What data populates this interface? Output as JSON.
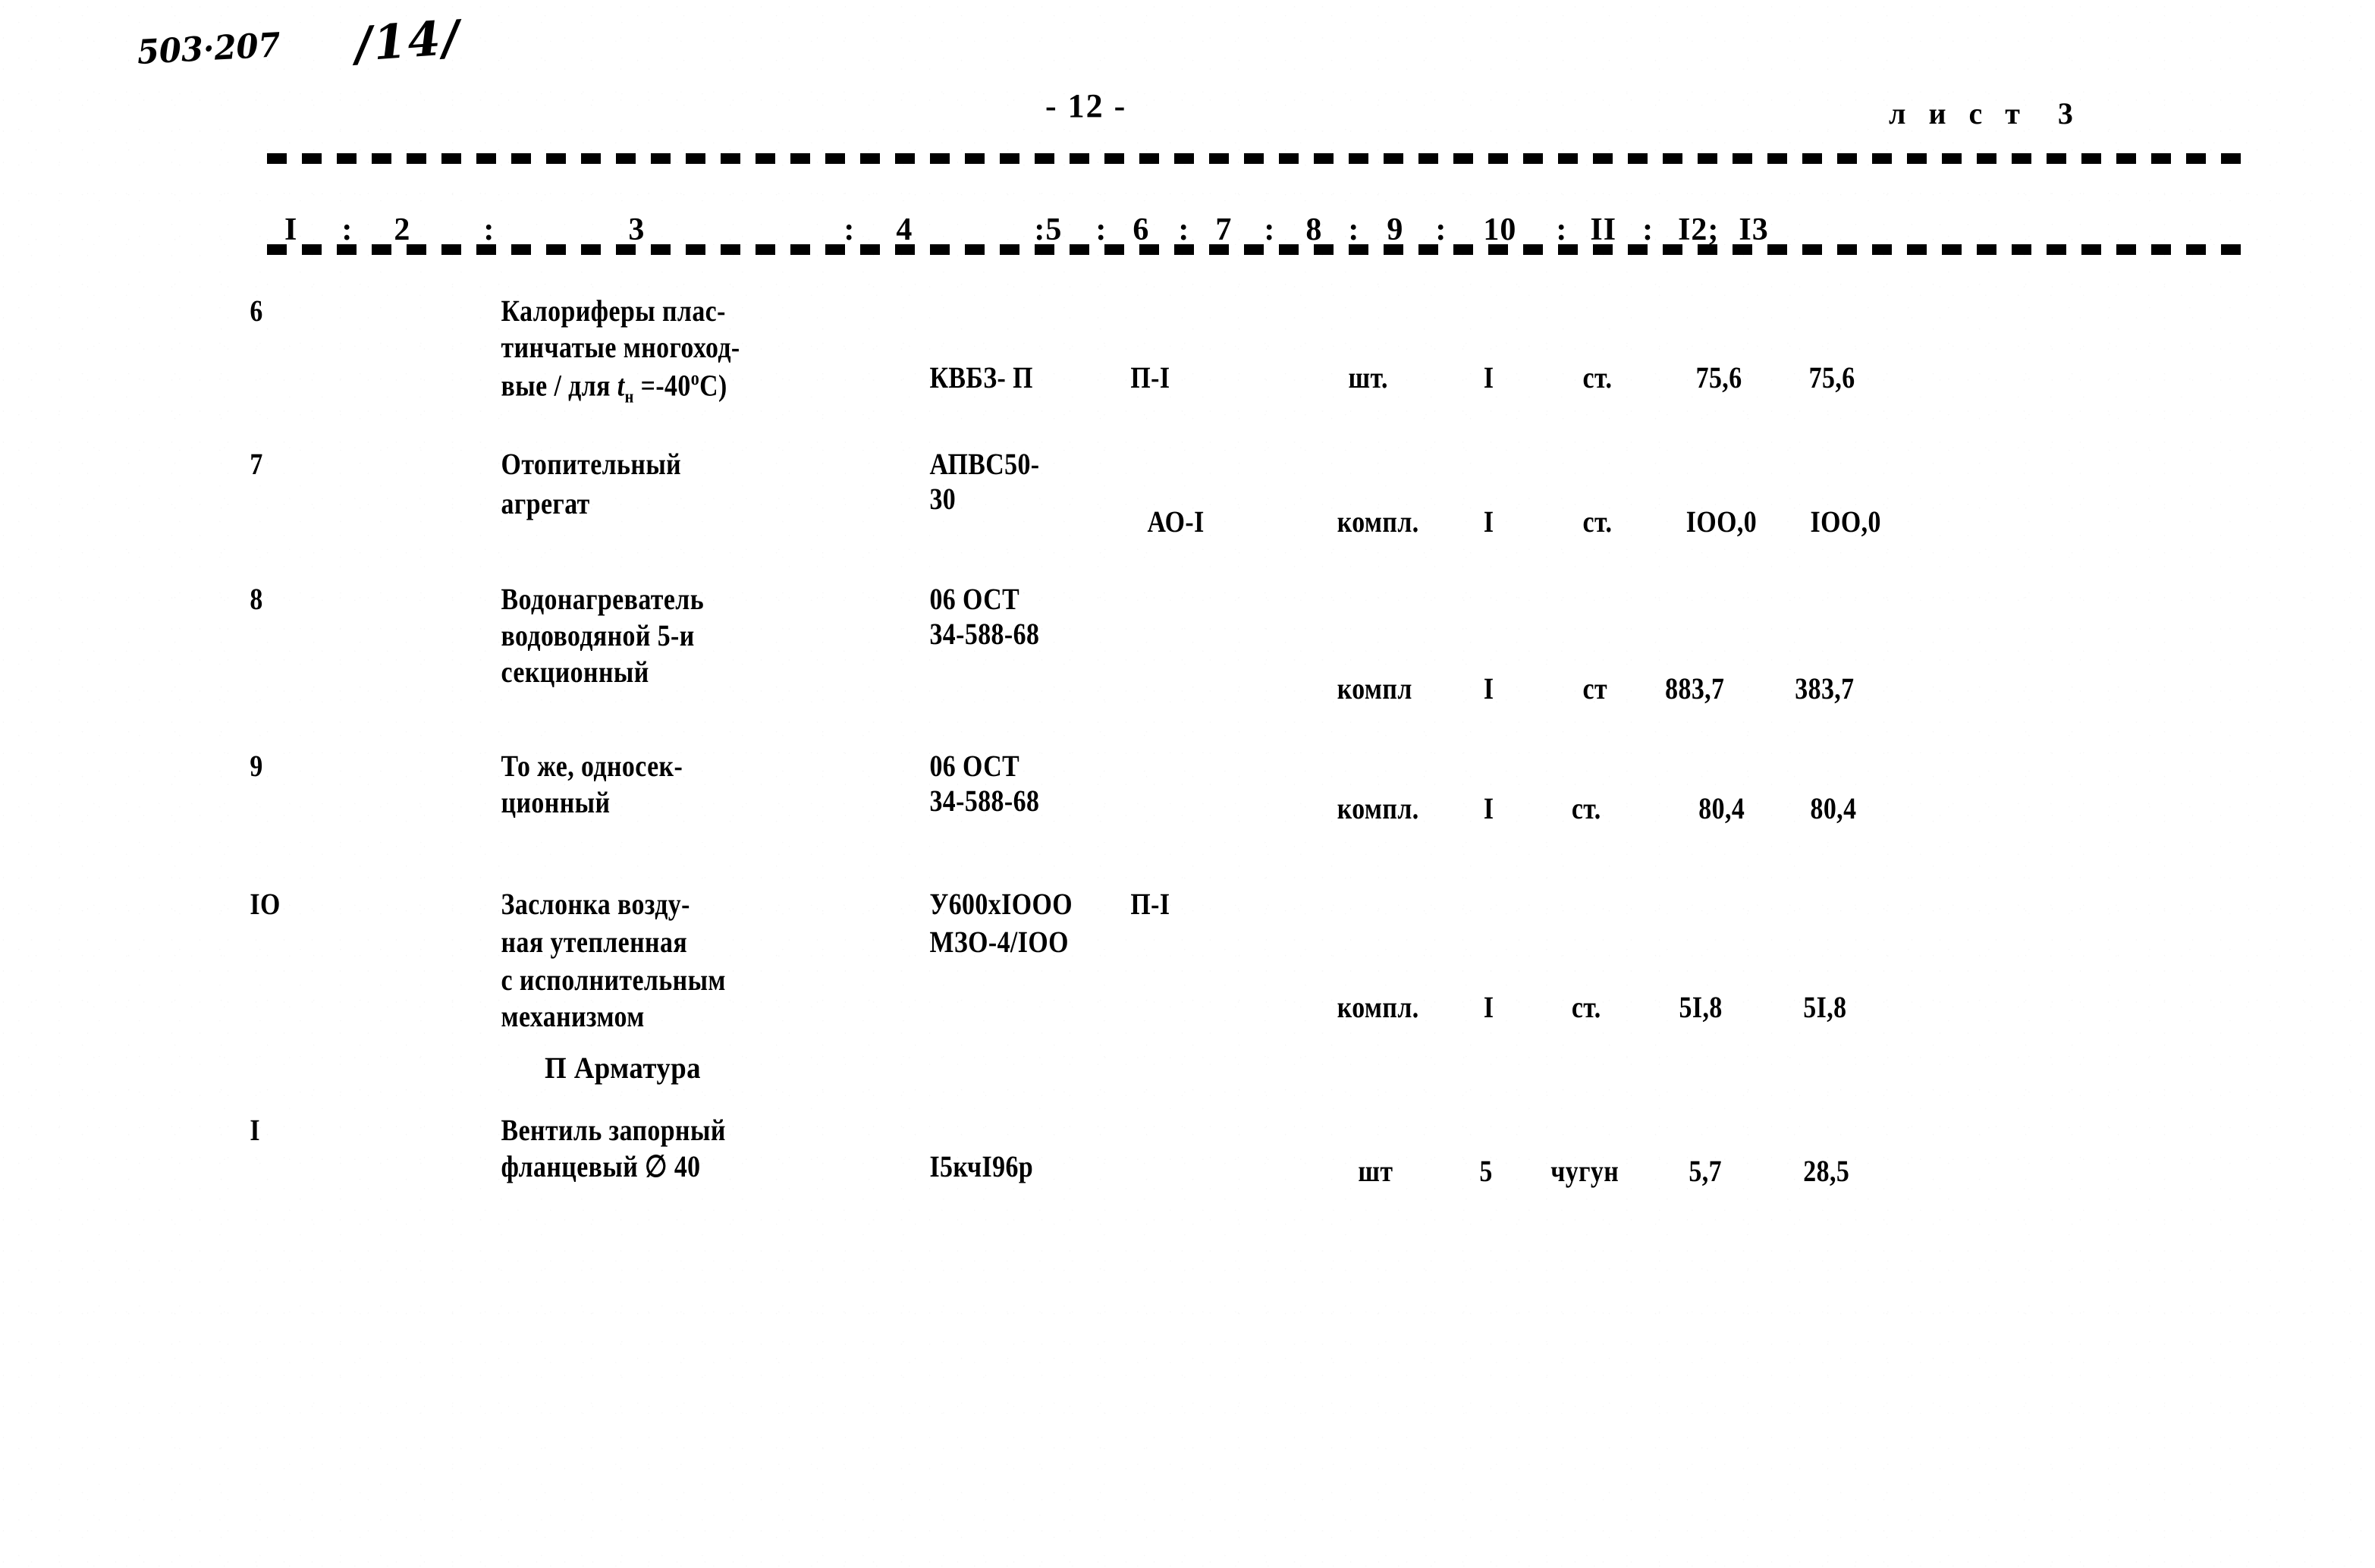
{
  "document": {
    "annotation_code": "503·207",
    "annotation_folio": "/14/",
    "page_marker": "- 12 -",
    "sheet_label": "л и с т  3"
  },
  "table": {
    "column_headers": [
      "I",
      ":",
      "2",
      ":",
      "3",
      ":",
      "4",
      ":5",
      ":",
      "6",
      ":",
      "7",
      ":",
      "8",
      ":",
      "9",
      ":",
      "10",
      ":",
      "II",
      ":",
      "I2;",
      "I3"
    ],
    "header_line": "I : 2 : 3 : 4 :5 : 6 : 7 : 8 : 9 : 10 : II : I2; I3",
    "rows": [
      {
        "pos": "6",
        "name_lines": [
          "Калориферы плас-",
          "тинчатые многоход-",
          "вые / для tн =-40°C)"
        ],
        "type_lines": [
          "КВБЗ- П"
        ],
        "mark": "П-I",
        "unit": "шт.",
        "qty": "I",
        "material": "ст.",
        "mass_unit": "75,6",
        "mass_total": "75,6"
      },
      {
        "pos": "7",
        "name_lines": [
          "Отопительный",
          "агрегат"
        ],
        "type_lines": [
          "АПВС50-",
          "30"
        ],
        "mark": "АО-I",
        "unit": "компл.",
        "qty": "I",
        "material": "ст.",
        "mass_unit": "IOO,0",
        "mass_total": "IOO,0"
      },
      {
        "pos": "8",
        "name_lines": [
          "Водонагреватель",
          "водоводяной 5-и",
          "секционный"
        ],
        "type_lines": [
          "06 ОСТ",
          "34-588-68"
        ],
        "mark": "",
        "unit": "компл",
        "qty": "I",
        "material": "ст",
        "mass_unit": "883,7",
        "mass_total": "383,7"
      },
      {
        "pos": "9",
        "name_lines": [
          "То же, односек-",
          "ционный"
        ],
        "type_lines": [
          "06 ОСТ",
          "34-588-68"
        ],
        "mark": "",
        "unit": "компл.",
        "qty": "I",
        "material": "ст.",
        "mass_unit": "80,4",
        "mass_total": "80,4"
      },
      {
        "pos": "IO",
        "name_lines": [
          "Заслонка возду-",
          "ная утепленная",
          "с исполнительным",
          "механизмом"
        ],
        "type_lines": [
          "У600хIOOO",
          "МЗО-4/IOO"
        ],
        "mark": "П-I",
        "unit": "компл.",
        "qty": "I",
        "material": "ст.",
        "mass_unit": "5I,8",
        "mass_total": "5I,8"
      },
      {
        "pos": "I",
        "name_lines": [
          "Вентиль запорный",
          "фланцевый ∅ 40"
        ],
        "type_lines": [
          "I5кчI96р"
        ],
        "mark": "",
        "unit": "шт",
        "qty": "5",
        "material": "чугун",
        "mass_unit": "5,7",
        "mass_total": "28,5"
      }
    ],
    "section_heading": "П Арматура"
  }
}
